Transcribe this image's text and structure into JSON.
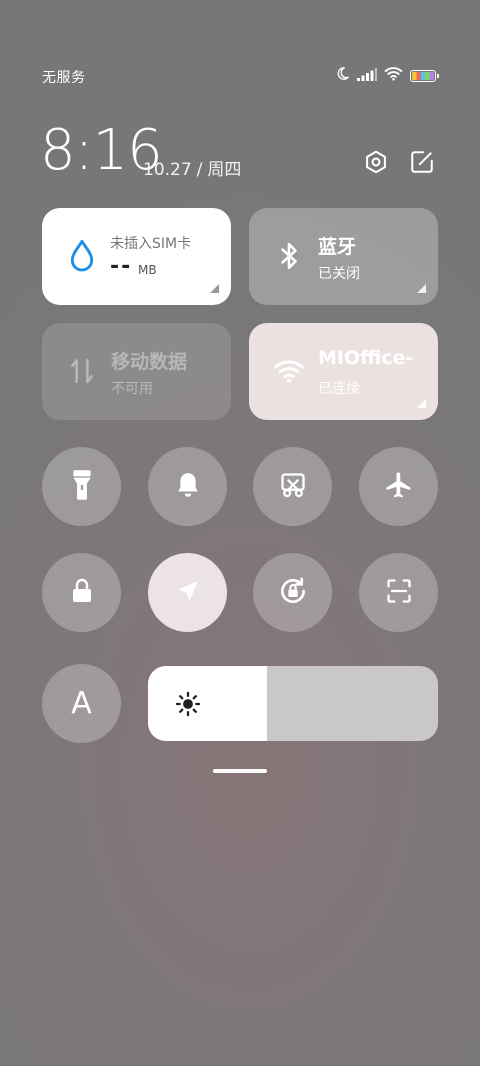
{
  "status_bar": {
    "carrier": "无服务",
    "icons": [
      "moon-icon",
      "signal-icon",
      "wifi-icon",
      "battery-icon"
    ]
  },
  "header": {
    "time": "8:16",
    "date": "10.27",
    "date_separator": "/",
    "weekday": "周四",
    "buttons": [
      "settings-icon",
      "edit-icon"
    ]
  },
  "tiles": {
    "data_usage": {
      "label": "未插入SIM卡",
      "value": "--",
      "unit": "MB",
      "icon": "water-drop-icon"
    },
    "bluetooth": {
      "title": "蓝牙",
      "status": "已关闭",
      "icon": "bluetooth-icon"
    },
    "mobile_data": {
      "title": "移动数据",
      "status": "不可用",
      "icon": "arrows-updown-icon"
    },
    "wifi": {
      "title": "MIOffice-",
      "status": "已连接",
      "icon": "wifi-icon"
    }
  },
  "toggles_row1": [
    {
      "name": "flashlight-toggle",
      "icon": "flashlight-icon",
      "on": false
    },
    {
      "name": "ringer-toggle",
      "icon": "bell-icon",
      "on": false
    },
    {
      "name": "screenshot-toggle",
      "icon": "scissors-icon",
      "on": false
    },
    {
      "name": "airplane-toggle",
      "icon": "airplane-icon",
      "on": false
    }
  ],
  "toggles_row2": [
    {
      "name": "lock-toggle",
      "icon": "lock-icon",
      "on": false
    },
    {
      "name": "location-toggle",
      "icon": "location-arrow-icon",
      "on": true
    },
    {
      "name": "rotation-lock-toggle",
      "icon": "rotation-lock-icon",
      "on": false
    },
    {
      "name": "scanner-toggle",
      "icon": "scan-icon",
      "on": false
    }
  ],
  "auto_text_toggle": {
    "label": "A",
    "icon": "font-icon"
  },
  "brightness": {
    "level": 0.41,
    "icon": "sun-icon"
  },
  "colors": {
    "accent_blue": "#1e90e6",
    "tile_active": "#ffffff",
    "tile_wifi_on": "#ece1e1"
  }
}
